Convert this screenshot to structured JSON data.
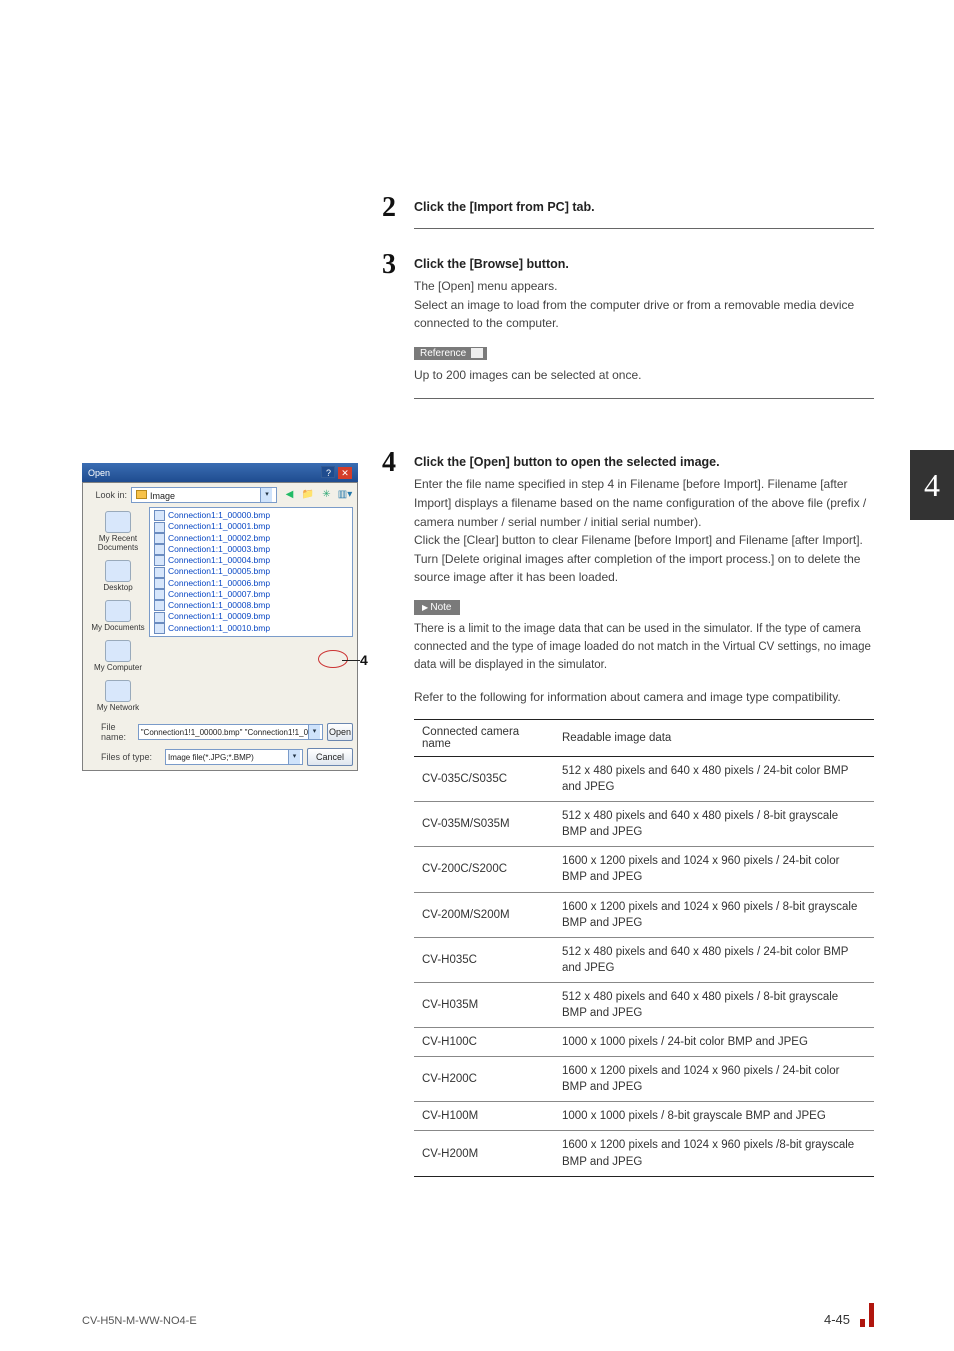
{
  "chapter": "4",
  "steps": {
    "s2": {
      "num": "2",
      "title": "Click the [Import from PC] tab."
    },
    "s3": {
      "num": "3",
      "title": "Click the [Browse] button.",
      "body1": "The [Open] menu appears.",
      "body2": "Select an image to load from the computer drive or from a removable media device connected to the computer."
    },
    "ref": {
      "label": "Reference",
      "text": "Up to 200 images can be selected at once."
    },
    "s4": {
      "num": "4",
      "title": "Click the [Open] button to open the selected image.",
      "body1": "Enter the file name specified in step 4 in Filename [before Import]. Filename [after Import] displays a filename based on the name configuration of the above file (prefix / camera number / serial number / initial serial number).",
      "body2": "Click the [Clear] button to clear Filename [before Import] and Filename [after Import].",
      "body3": "Turn [Delete original images after completion of the import process.] on to delete the source image after it has been loaded."
    },
    "note": {
      "label": "Note",
      "text": "There is a limit to the image data that can be used in the simulator. If the type of camera connected and the type of image loaded do not match in the Virtual CV settings, no image data will be displayed in the simulator."
    },
    "compat_intro": "Refer to the following for information about camera and image type compatibility."
  },
  "table": {
    "head": {
      "c1": "Connected camera name",
      "c2": "Readable image data"
    },
    "rows": [
      {
        "name": "CV-035C/S035C",
        "data": "512 x 480 pixels and 640 x 480 pixels / 24-bit color BMP and JPEG"
      },
      {
        "name": "CV-035M/S035M",
        "data": "512 x 480 pixels and 640 x 480 pixels / 8-bit grayscale BMP and JPEG"
      },
      {
        "name": "CV-200C/S200C",
        "data": "1600 x 1200 pixels and 1024 x 960 pixels / 24-bit color BMP and JPEG"
      },
      {
        "name": "CV-200M/S200M",
        "data": "1600 x 1200 pixels and 1024 x 960 pixels / 8-bit grayscale BMP and JPEG"
      },
      {
        "name": "CV-H035C",
        "data": "512 x 480 pixels and 640 x 480 pixels / 24-bit color BMP and JPEG"
      },
      {
        "name": "CV-H035M",
        "data": "512 x 480 pixels and 640 x 480 pixels / 8-bit grayscale BMP and JPEG"
      },
      {
        "name": "CV-H100C",
        "data": "1000 x 1000 pixels / 24-bit color BMP and JPEG"
      },
      {
        "name": "CV-H200C",
        "data": "1600 x 1200 pixels and 1024 x 960 pixels / 24-bit color BMP and JPEG"
      },
      {
        "name": "CV-H100M",
        "data": "1000 x 1000 pixels / 8-bit grayscale BMP and JPEG"
      },
      {
        "name": "CV-H200M",
        "data": "1600 x 1200 pixels and 1024 x 960 pixels /8-bit grayscale BMP and JPEG"
      }
    ]
  },
  "screenshot": {
    "title": "Open",
    "lookin_label": "Look in:",
    "lookin_value": "Image",
    "places": [
      {
        "label": "My Recent Documents"
      },
      {
        "label": "Desktop"
      },
      {
        "label": "My Documents"
      },
      {
        "label": "My Computer"
      },
      {
        "label": "My Network"
      }
    ],
    "files": [
      "Connection1:1_00000.bmp",
      "Connection1:1_00001.bmp",
      "Connection1:1_00002.bmp",
      "Connection1:1_00003.bmp",
      "Connection1:1_00004.bmp",
      "Connection1:1_00005.bmp",
      "Connection1:1_00006.bmp",
      "Connection1:1_00007.bmp",
      "Connection1:1_00008.bmp",
      "Connection1:1_00009.bmp",
      "Connection1:1_00010.bmp"
    ],
    "filename_label": "File name:",
    "filename_value": "\"Connection1!1_00000.bmp\" \"Connection1!1_0",
    "filetype_label": "Files of type:",
    "filetype_value": "Image file(*.JPG;*.BMP)",
    "open_btn": "Open",
    "cancel_btn": "Cancel"
  },
  "callout4": "4",
  "footer": {
    "doc": "CV-H5N-M-WW-NO4-E",
    "page": "4-45"
  }
}
